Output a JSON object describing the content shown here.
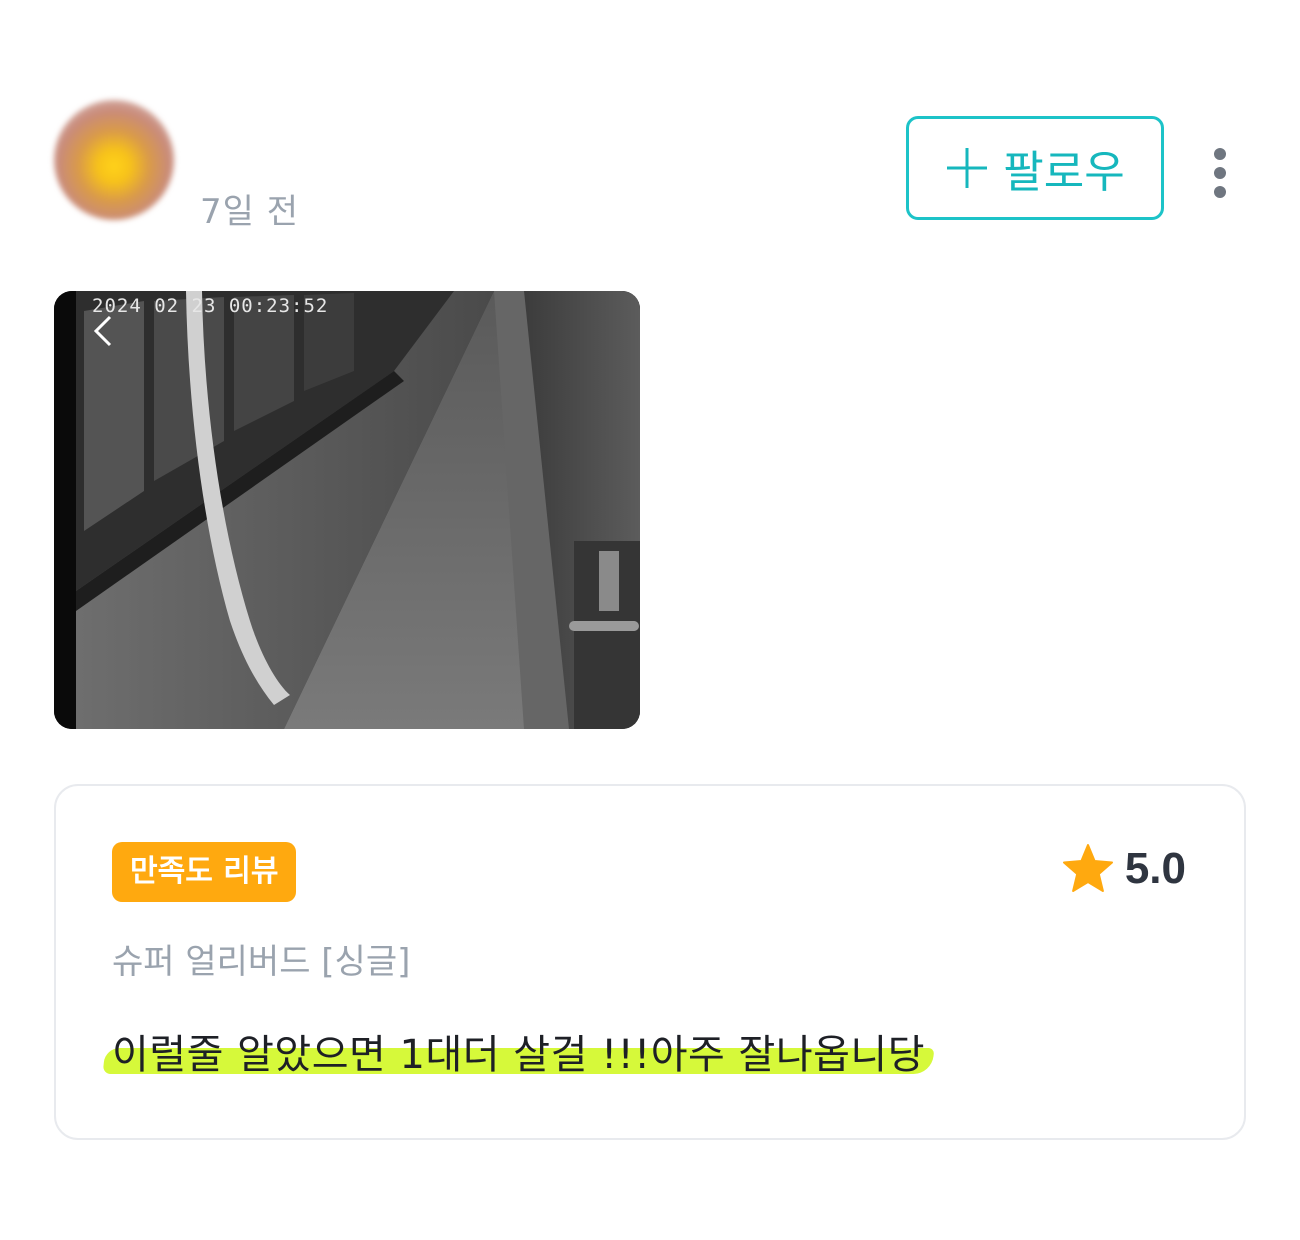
{
  "header": {
    "time_ago": "7일 전",
    "follow_label": "팔로우"
  },
  "photo": {
    "timestamp": "2024 02 23  00:23:52"
  },
  "review": {
    "badge": "만족도 리뷰",
    "rating": "5.0",
    "option": "슈퍼 얼리버드 [싱글]",
    "text": "이럴줄 알았으면 1대더 살걸 !!!아주 잘나옵니당"
  },
  "colors": {
    "follow_accent": "#1cc3c8",
    "badge_bg": "#ffa90f",
    "star": "#ffa90f",
    "highlight": "#d6f93a"
  },
  "icons": {
    "follow": "plus-icon",
    "menu": "more-vertical-icon",
    "rating": "star-icon",
    "photo_nav": "chevron-left-icon"
  }
}
